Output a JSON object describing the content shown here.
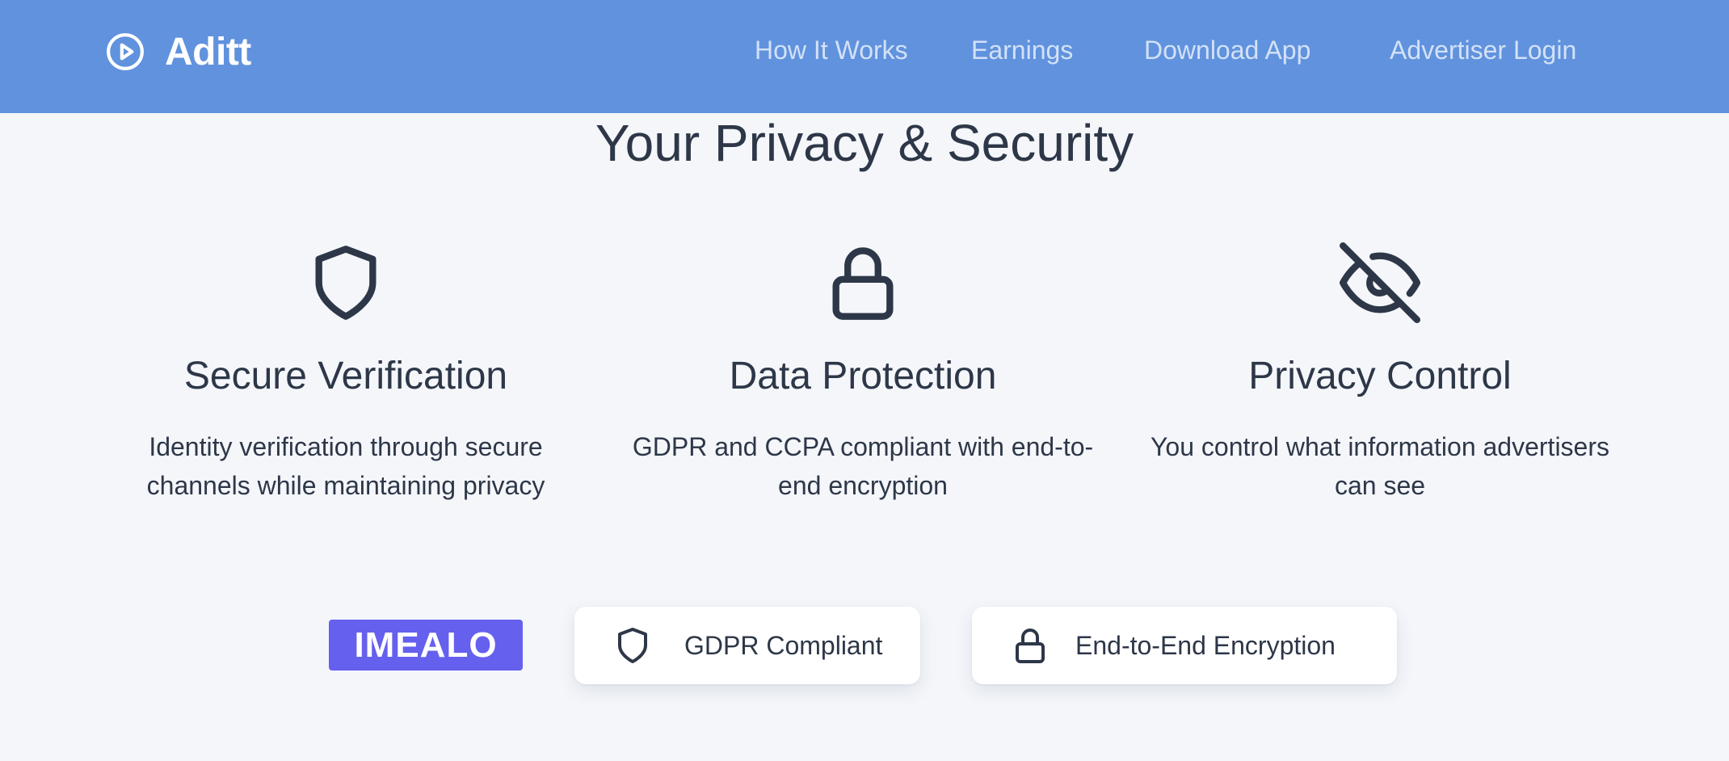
{
  "header": {
    "brand": {
      "name": "Aditt",
      "icon": "play-circle-icon"
    },
    "nav": [
      {
        "label": "How It Works"
      },
      {
        "label": "Earnings"
      },
      {
        "label": "Download App"
      },
      {
        "label": "Advertiser Login"
      }
    ]
  },
  "main": {
    "title": "Your Privacy & Security",
    "features": [
      {
        "icon": "shield-icon",
        "title": "Secure Verification",
        "description": "Identity verification through secure channels while maintaining privacy"
      },
      {
        "icon": "lock-icon",
        "title": "Data Protection",
        "description": "GDPR and CCPA compliant with end-to-end encryption"
      },
      {
        "icon": "eye-off-icon",
        "title": "Privacy Control",
        "description": "You control what information advertisers can see"
      }
    ],
    "badges": {
      "logo": {
        "text": "IMEALO",
        "color": "#6560ee"
      },
      "items": [
        {
          "icon": "shield-icon",
          "label": "GDPR Compliant"
        },
        {
          "icon": "lock-icon",
          "label": "End-to-End Encryption"
        }
      ]
    }
  },
  "colors": {
    "header_bg": "#6092de",
    "page_bg": "#f4f6fa",
    "text": "#2d3748",
    "nav_text": "#d3e1f7"
  }
}
